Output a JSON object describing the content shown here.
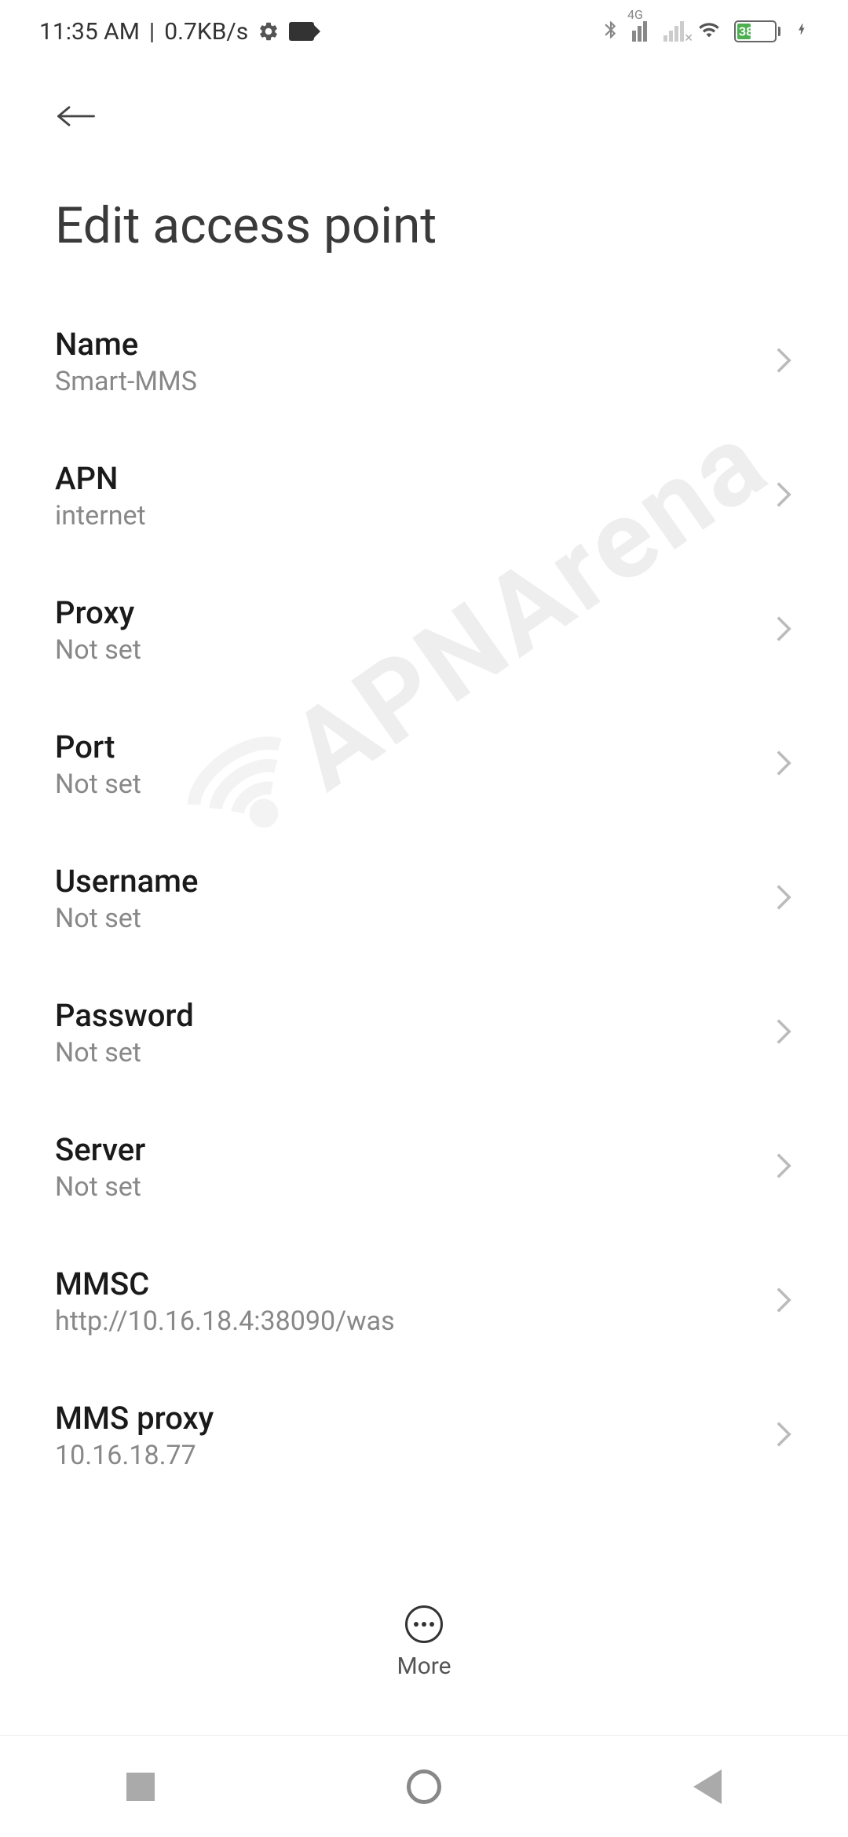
{
  "status": {
    "time": "11:35 AM",
    "separator": "|",
    "speed": "0.7KB/s",
    "network_badge": "4G",
    "battery_percent": "38"
  },
  "header": {
    "title": "Edit access point"
  },
  "settings": [
    {
      "label": "Name",
      "value": "Smart-MMS"
    },
    {
      "label": "APN",
      "value": "internet"
    },
    {
      "label": "Proxy",
      "value": "Not set"
    },
    {
      "label": "Port",
      "value": "Not set"
    },
    {
      "label": "Username",
      "value": "Not set"
    },
    {
      "label": "Password",
      "value": "Not set"
    },
    {
      "label": "Server",
      "value": "Not set"
    },
    {
      "label": "MMSC",
      "value": "http://10.16.18.4:38090/was"
    },
    {
      "label": "MMS proxy",
      "value": "10.16.18.77"
    }
  ],
  "bottom": {
    "more_label": "More"
  },
  "watermark": {
    "text": "APNArena"
  }
}
